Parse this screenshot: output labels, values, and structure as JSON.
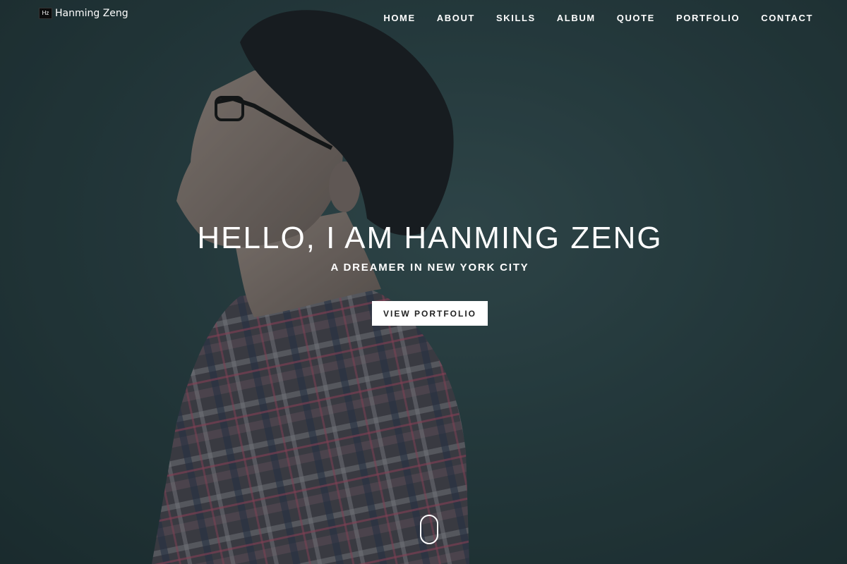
{
  "brand": {
    "logo_text": "Hz",
    "name": "Hanming Zeng"
  },
  "nav": {
    "items": [
      {
        "label": "HOME"
      },
      {
        "label": "ABOUT"
      },
      {
        "label": "SKILLS"
      },
      {
        "label": "ALBUM"
      },
      {
        "label": "QUOTE"
      },
      {
        "label": "PORTFOLIO"
      },
      {
        "label": "CONTACT"
      }
    ]
  },
  "hero": {
    "headline": "HELLO, I AM HANMING ZENG",
    "subhead": "A DREAMER IN NEW YORK CITY",
    "cta_label": "VIEW PORTFOLIO",
    "background_color": "#2c4447",
    "scroll_icon": "mouse-scroll-icon"
  }
}
